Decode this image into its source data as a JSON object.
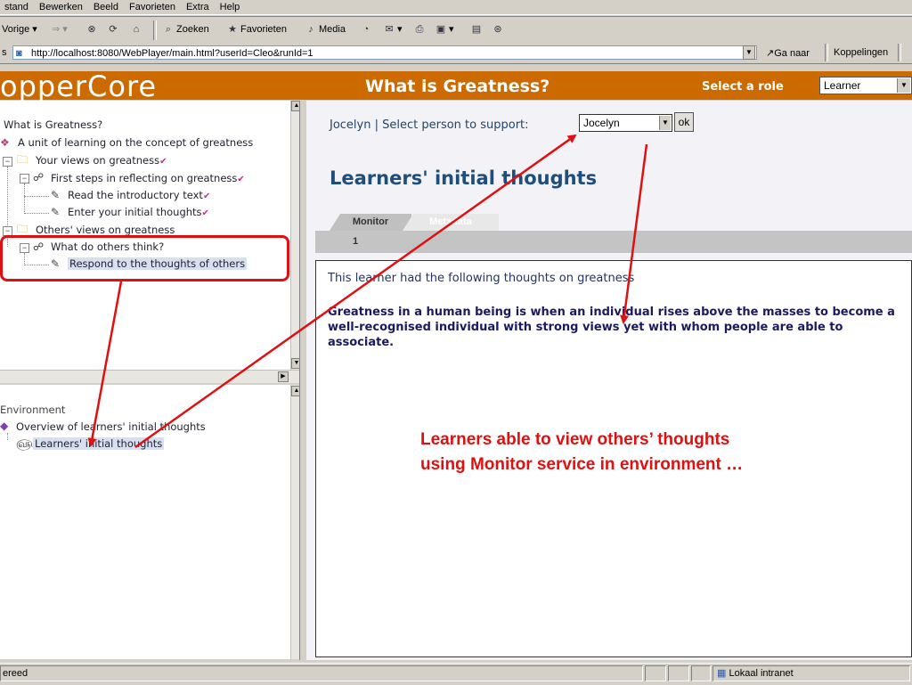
{
  "browser": {
    "menu": [
      "stand",
      "Bewerken",
      "Beeld",
      "Favorieten",
      "Extra",
      "Help"
    ],
    "toolbar": {
      "back": "Vorige",
      "search": "Zoeken",
      "favorites": "Favorieten",
      "media": "Media"
    },
    "address_url": "http://localhost:8080/WebPlayer/main.html?userId=Cleo&runId=1",
    "go_label": "Ga naar",
    "links_label": "Koppelingen",
    "status_text": "ereed",
    "zone_text": "Lokaal intranet"
  },
  "app": {
    "logo": "opperCore",
    "title": "What is Greatness?",
    "role_label": "Select a role",
    "role_value": "Learner"
  },
  "tree": {
    "root": "What is Greatness?",
    "items": [
      "A unit of learning on the concept of greatness",
      "Your views on greatness",
      "First steps in reflecting on greatness",
      "Read the introductory text",
      "Enter your initial thoughts",
      "Others' views on greatness",
      "What do others think?",
      "Respond to the thoughts of others"
    ]
  },
  "environment": {
    "root": "Environment",
    "items": [
      "Overview of learners' initial thoughts",
      "Learners' initial thoughts"
    ]
  },
  "content": {
    "select_label": "Jocelyn | Select person to support:",
    "person_value": "Jocelyn",
    "ok_label": "ok",
    "heading": "Learners' initial thoughts",
    "tabs": [
      "Monitor",
      "Metadata"
    ],
    "page_number": "1",
    "intro": "This learner had the following thoughts on greatness",
    "thought": "Greatness in a human being is when an individual rises above the masses to become a well-recognised individual with strong views yet with whom people are able to associate."
  },
  "annotation": {
    "line1": "Learners able to view others’ thoughts",
    "line2": "using Monitor service in environment …",
    "color": "#e01010"
  }
}
